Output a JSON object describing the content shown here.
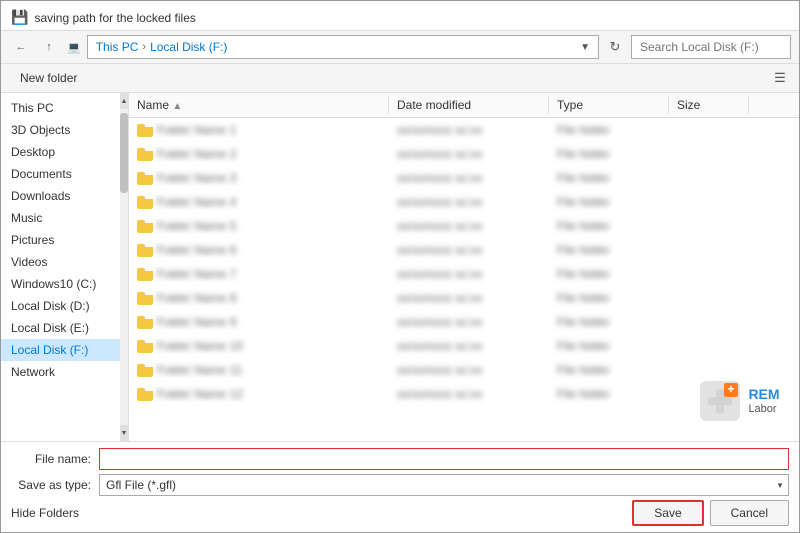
{
  "dialog": {
    "title": "saving path for the locked files",
    "address": {
      "back_tooltip": "Back",
      "up_tooltip": "Up",
      "path_parts": [
        "This PC",
        "Local Disk (F:)"
      ],
      "search_placeholder": "Search Local Disk (F:)"
    },
    "toolbar": {
      "new_folder": "New folder"
    },
    "sidebar": {
      "items": [
        {
          "label": "This PC",
          "active": false
        },
        {
          "label": "3D Objects",
          "active": false
        },
        {
          "label": "Desktop",
          "active": false
        },
        {
          "label": "Documents",
          "active": false
        },
        {
          "label": "Downloads",
          "active": false
        },
        {
          "label": "Music",
          "active": false
        },
        {
          "label": "Pictures",
          "active": false
        },
        {
          "label": "Videos",
          "active": false
        },
        {
          "label": "Windows10 (C:)",
          "active": false
        },
        {
          "label": "Local Disk (D:)",
          "active": false
        },
        {
          "label": "Local Disk (E:)",
          "active": false
        },
        {
          "label": "Local Disk (F:)",
          "active": true
        },
        {
          "label": "Network",
          "active": false
        }
      ]
    },
    "file_list": {
      "columns": [
        "Name",
        "Date modified",
        "Type",
        "Size"
      ],
      "rows": [
        {
          "name": "Folder 1",
          "date": "",
          "type": "",
          "size": ""
        },
        {
          "name": "Folder 2",
          "date": "",
          "type": "",
          "size": ""
        },
        {
          "name": "Folder 3",
          "date": "",
          "type": "",
          "size": ""
        },
        {
          "name": "Folder 4",
          "date": "",
          "type": "",
          "size": ""
        },
        {
          "name": "Folder 5",
          "date": "",
          "type": "",
          "size": ""
        },
        {
          "name": "Folder 6",
          "date": "",
          "type": "",
          "size": ""
        },
        {
          "name": "Folder 7",
          "date": "",
          "type": "",
          "size": ""
        },
        {
          "name": "Folder 8",
          "date": "",
          "type": "",
          "size": ""
        },
        {
          "name": "Folder 9",
          "date": "",
          "type": "",
          "size": ""
        },
        {
          "name": "Folder 10",
          "date": "",
          "type": "",
          "size": ""
        },
        {
          "name": "Folder 11",
          "date": "",
          "type": "",
          "size": ""
        },
        {
          "name": "Folder 12",
          "date": "",
          "type": "",
          "size": ""
        }
      ]
    },
    "watermark": {
      "text_line1": "REM",
      "text_line2": "Labor"
    },
    "bottom": {
      "filename_label": "File name:",
      "filename_value": "",
      "filetype_label": "Save as type:",
      "filetype_value": "Gfl File (*.gfl)",
      "hide_folders": "Hide Folders",
      "save_btn": "Save",
      "cancel_btn": "Cancel"
    }
  }
}
